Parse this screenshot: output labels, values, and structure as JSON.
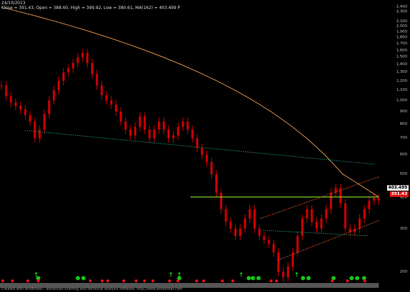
{
  "header": {
    "date": "24/10/2013",
    "ohlc_line": "Close = 391.43,   Open = 388.60,   High = 399.92,   Low = 380.61,  MA(162) = 403.499  P"
  },
  "y_axis": {
    "scale": "log",
    "labels": [
      "2,400",
      "2,300",
      "2,100",
      "2,000",
      "1,900",
      "1,800",
      "1,700",
      "1,600",
      "1,500",
      "1,400",
      "1,300",
      "1,200",
      "1,100",
      "1,000",
      "900",
      "800",
      "700",
      "600",
      "500",
      "400",
      "300",
      "200"
    ]
  },
  "price_tags": {
    "ma_value": "403.499",
    "close_value": "391.43"
  },
  "colors": {
    "background": "#000000",
    "candle": "#cc0000",
    "ma_line": "#d9904a",
    "dotted_support": "#1fa07a",
    "resistance": "#a0ff40",
    "channel": "#d24a2a",
    "green_marker": "#14c814",
    "red_marker": "#e01010"
  },
  "footer": {
    "credit": "Created with AmiBroker - advanced charting and technical analysis software. http://www.amibroker.com"
  },
  "chart_data": {
    "type": "line",
    "series": [
      {
        "values": [
          1150,
          1040,
          980,
          950,
          920,
          870,
          820,
          700,
          760,
          880,
          1000,
          1100,
          1200,
          1300,
          1350,
          1420,
          1500,
          1560,
          1420,
          1280,
          1150,
          1050,
          1000,
          960,
          900,
          820,
          760,
          720,
          780,
          860,
          760,
          700,
          760,
          820,
          760,
          700,
          720,
          780,
          820,
          760,
          700,
          640,
          600,
          560,
          500,
          420,
          360,
          320,
          300,
          280,
          300,
          330,
          360,
          300,
          280,
          270,
          260,
          240,
          200,
          190,
          210,
          240,
          280,
          330,
          360,
          320,
          300,
          330,
          360,
          420,
          440,
          380,
          300,
          290,
          300,
          330,
          360,
          390,
          400,
          390
        ]
      },
      {
        "values": [
          2400,
          2300,
          2200,
          2100,
          2000,
          1900,
          1800,
          1700,
          1600,
          1500,
          1400,
          1300,
          1200,
          1100,
          1000,
          900,
          800,
          700,
          600,
          500,
          450,
          403.499
        ]
      }
    ],
    "ylim": [
      180,
      2500
    ],
    "resistance_level": 403.499,
    "grid": false
  }
}
